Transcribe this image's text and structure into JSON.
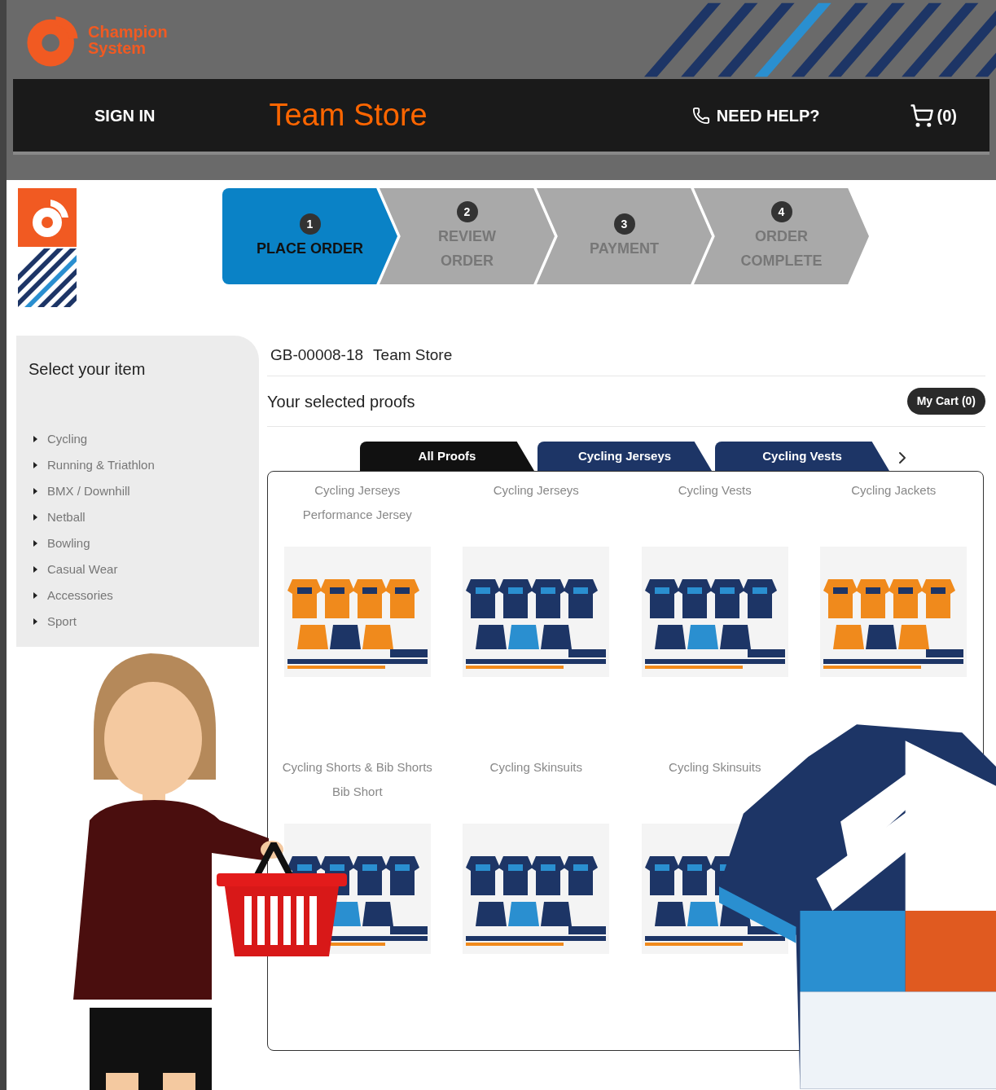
{
  "header": {
    "logo_lines": [
      "Champion",
      "System"
    ]
  },
  "nav": {
    "sign_in": "SIGN IN",
    "title": "Team Store",
    "help": "NEED HELP?",
    "cart_count": "(0)"
  },
  "steps": [
    {
      "number": "1",
      "lines": [
        "PLACE ORDER"
      ],
      "selected": true
    },
    {
      "number": "2",
      "lines": [
        "REVIEW",
        "ORDER"
      ],
      "selected": false
    },
    {
      "number": "3",
      "lines": [
        "PAYMENT"
      ],
      "selected": false
    },
    {
      "number": "4",
      "lines": [
        "ORDER",
        "COMPLETE"
      ],
      "selected": false
    }
  ],
  "sidebar": {
    "title": "Select your item",
    "items": [
      "Cycling",
      "Running & Triathlon",
      "BMX / Downhill",
      "Netball",
      "Bowling",
      "Casual Wear",
      "Accessories",
      "Sport"
    ]
  },
  "store": {
    "id": "GB-00008-18",
    "name": "Team Store"
  },
  "proofs_title": "Your selected proofs",
  "cart_button": "My Cart (0)",
  "tabs": [
    {
      "label": "All Proofs",
      "selected": true
    },
    {
      "label": "Cycling Jerseys",
      "selected": false
    },
    {
      "label": "Cycling Vests",
      "selected": false
    }
  ],
  "proofs": [
    {
      "category": "Cycling Jerseys",
      "name": "Performance Jersey"
    },
    {
      "category": "Cycling Jerseys"
    },
    {
      "category": "Cycling Vests"
    },
    {
      "category": "Cycling Jackets"
    },
    {
      "category": "Cycling Shorts & Bib Shorts",
      "name": "Bib Short"
    },
    {
      "category": "Cycling Skinsuits"
    },
    {
      "category": "Cycling Skinsuits"
    }
  ]
}
